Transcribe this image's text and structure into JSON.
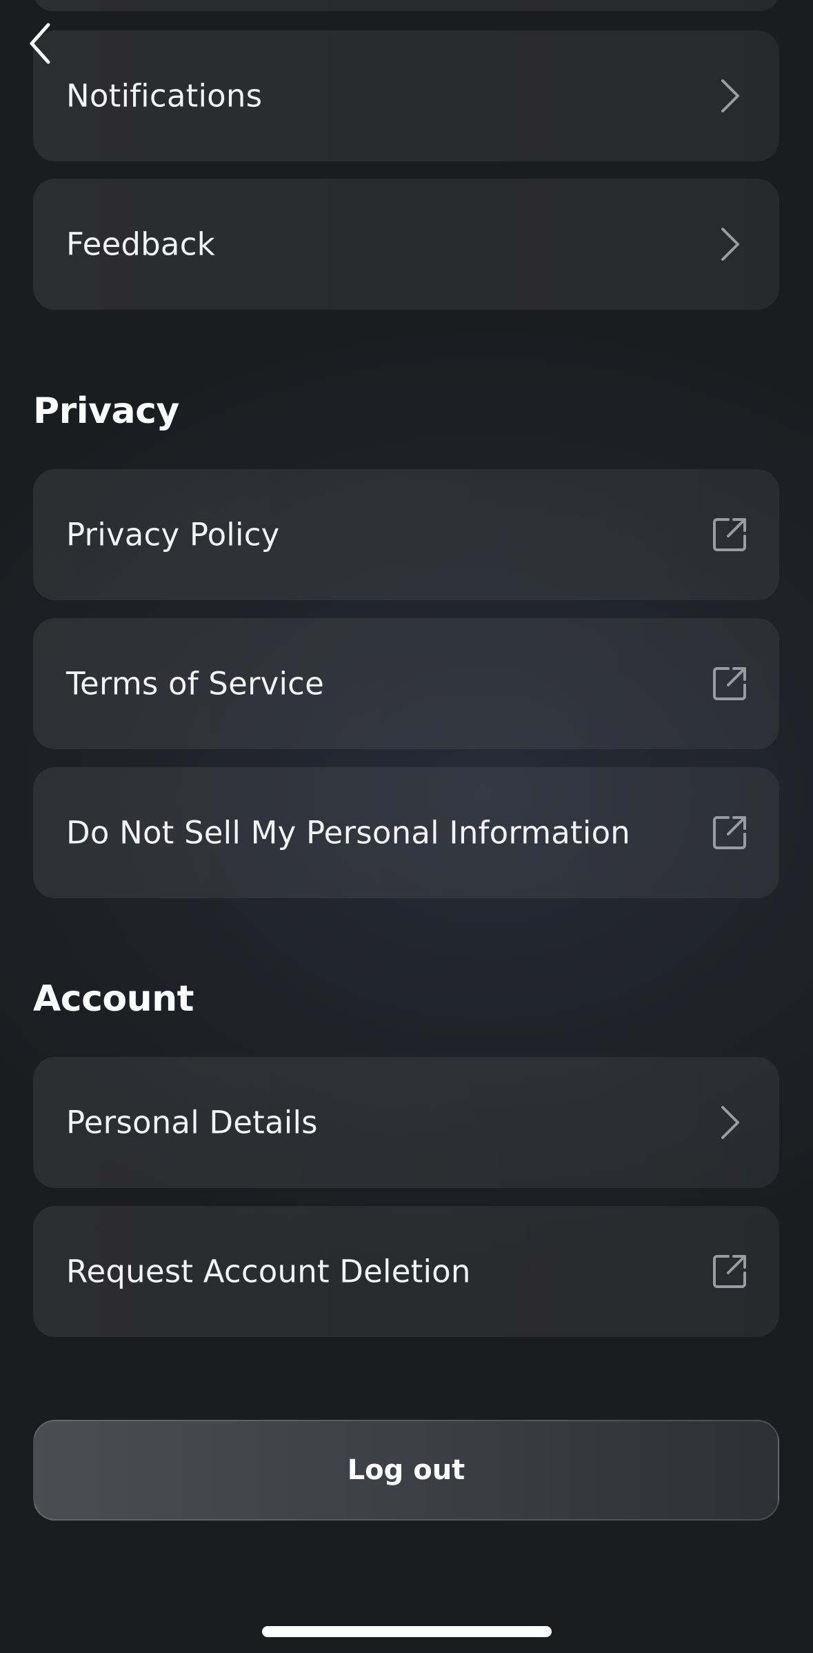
{
  "icons": {
    "back": "chevron-left-icon",
    "navigate": "chevron-right-icon",
    "external": "external-link-icon"
  },
  "colors": {
    "background": "#1f2229",
    "card": "#2a2d33",
    "text": "#f4f4f6",
    "icon": "#9a9ca3",
    "logout_button": "#40434a"
  },
  "support_items": [
    {
      "label": "Notifications",
      "icon": "chevron-right-icon"
    },
    {
      "label": "Feedback",
      "icon": "chevron-right-icon"
    }
  ],
  "privacy": {
    "title": "Privacy",
    "items": [
      {
        "label": "Privacy Policy",
        "icon": "external-link-icon"
      },
      {
        "label": "Terms of Service",
        "icon": "external-link-icon"
      },
      {
        "label": "Do Not Sell My Personal Information",
        "icon": "external-link-icon"
      }
    ]
  },
  "account": {
    "title": "Account",
    "items": [
      {
        "label": "Personal Details",
        "icon": "chevron-right-icon"
      },
      {
        "label": "Request Account Deletion",
        "icon": "external-link-icon"
      }
    ]
  },
  "logout": {
    "label": "Log out"
  }
}
